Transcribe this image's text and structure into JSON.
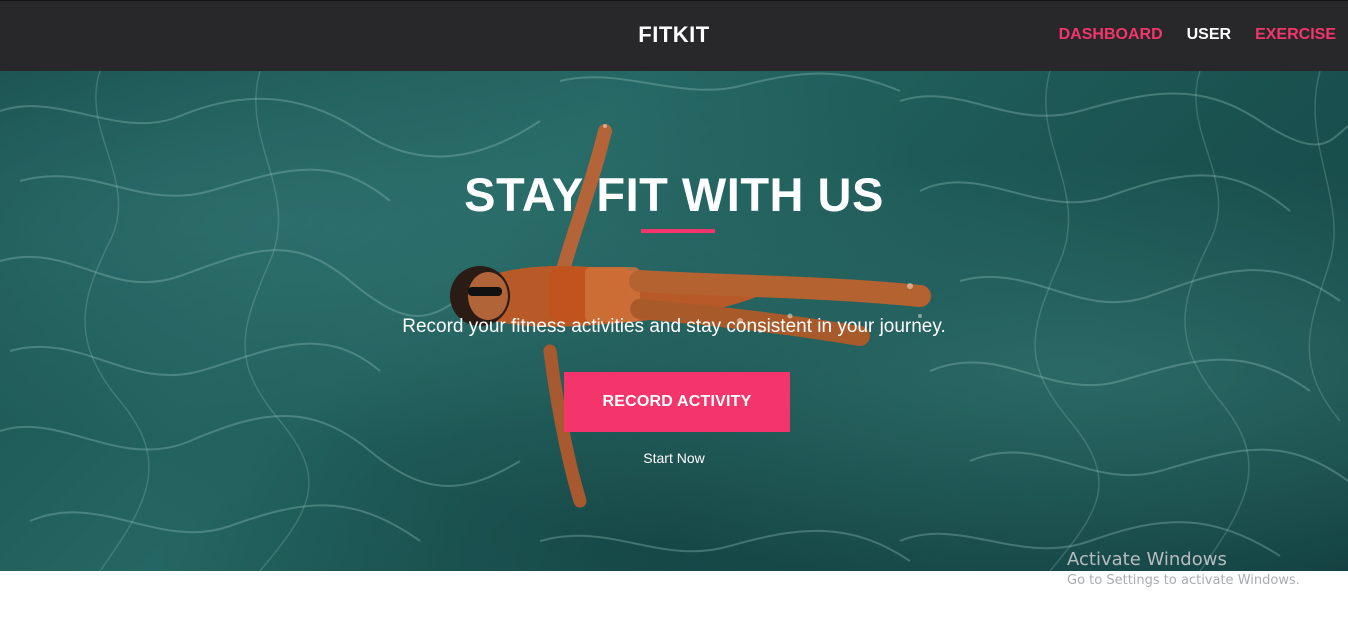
{
  "navbar": {
    "brand": "FITKIT",
    "links": [
      {
        "label": "DASHBOARD",
        "color": "#f4356b"
      },
      {
        "label": "USER",
        "color": "#ffffff"
      },
      {
        "label": "EXERCISE",
        "color": "#f4356b"
      }
    ]
  },
  "hero": {
    "title": "STAY FIT WITH US",
    "subtitle": "Record your fitness activities and stay consistent in your journey.",
    "cta_label": "RECORD ACTIVITY",
    "secondary_label": "Start Now",
    "accent_color": "#f4356b",
    "background_image": "woman-floating-in-pool-photo"
  },
  "watermark": {
    "title": "Activate Windows",
    "subtitle": "Go to Settings to activate Windows."
  }
}
